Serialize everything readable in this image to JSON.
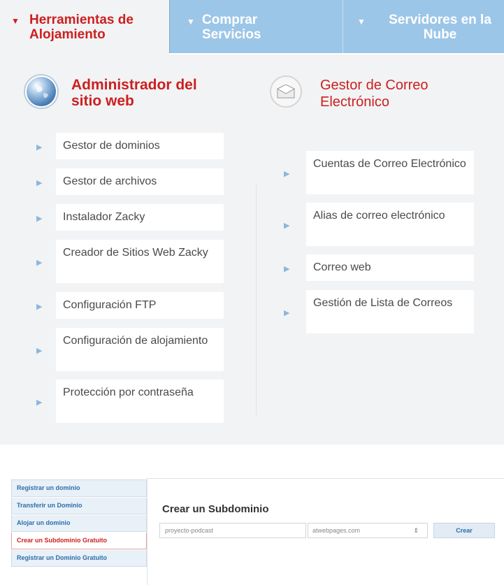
{
  "tabs": [
    {
      "label": "Herramientas de Alojamiento",
      "active": true
    },
    {
      "label": "Comprar Servicios",
      "active": false
    },
    {
      "label": "Servidores en la Nube",
      "active": false
    }
  ],
  "web_section": {
    "title": "Administrador del sitio web",
    "icon": "globe-icon",
    "items": [
      "Gestor de dominios",
      "Gestor de archivos",
      "Instalador Zacky",
      "Creador de Sitios Web Zacky",
      "Configuración FTP",
      "Configuración de alojamiento",
      "Protección por contraseña"
    ]
  },
  "mail_section": {
    "title": "Gestor de Correo Electrónico",
    "icon": "envelope-icon",
    "items": [
      "Cuentas de Correo Electrónico",
      "Alias de correo electrónico",
      "Correo web",
      "Gestión de Lista de Correos"
    ]
  },
  "left_nav": [
    {
      "label": "Registrar un dominio",
      "active": false
    },
    {
      "label": "Transferir un Dominio",
      "active": false
    },
    {
      "label": "Alojar un dominio",
      "active": false
    },
    {
      "label": "Crear un Subdominio Gratuito",
      "active": true
    },
    {
      "label": "Registrar un Dominio Gratuito",
      "active": false
    }
  ],
  "subdomain": {
    "title": "Crear un Subdominio",
    "input_value": "proyecto-podcast",
    "domain_value": "atwebpages.com",
    "button_label": "Crear"
  },
  "colors": {
    "accent_red": "#cc1f1f",
    "tab_blue": "#9cc6e8",
    "link_blue": "#2f6ea8",
    "panel_bg": "#f2f3f4"
  }
}
